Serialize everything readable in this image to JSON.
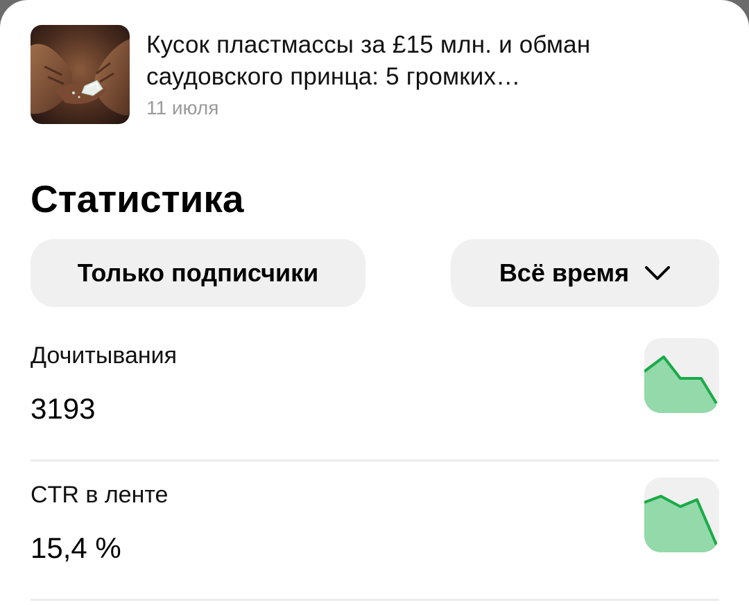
{
  "article": {
    "title": "Кусок пластмассы за £15 млн. и обман саудовского принца: 5 громких…",
    "date": "11 июля",
    "thumbnail_icon": "hands-holding-stone-photo"
  },
  "statistics": {
    "heading": "Статистика",
    "filters": {
      "audience_label": "Только подписчики",
      "period_label": "Всё время",
      "period_icon": "chevron-down-icon"
    },
    "items": [
      {
        "label": "Дочитывания",
        "value": "3193",
        "trend_icon": "sparkline-chart-icon"
      },
      {
        "label": "CTR в ленте",
        "value": "15,4 %",
        "trend_icon": "sparkline-chart-icon"
      }
    ]
  },
  "colors": {
    "accent_line": "#1aaa47",
    "accent_fill": "#93d9aa",
    "pill_bg": "#f0f0f0",
    "muted_text": "#9a9a9a"
  }
}
